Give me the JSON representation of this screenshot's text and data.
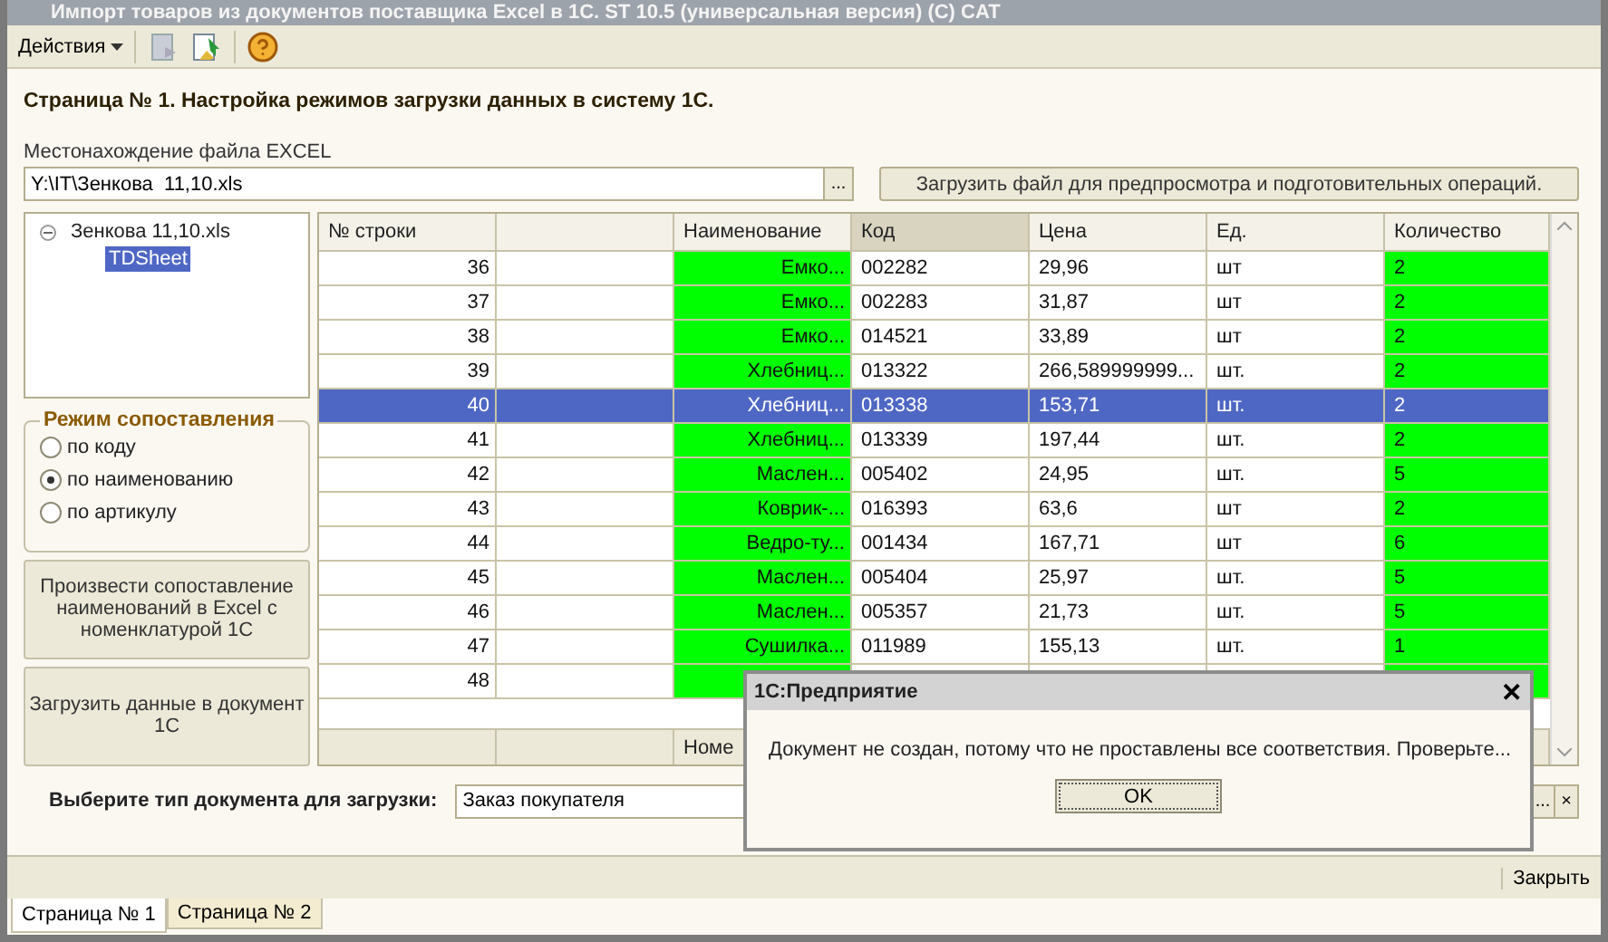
{
  "window": {
    "title": "Импорт товаров из документов поставщика Excel в 1С. ST 10.5 (универсальная версия) (С) CAT"
  },
  "toolbar": {
    "actions_menu": "Действия"
  },
  "heading": "Страница № 1. Настройка режимов загрузки данных в систему 1С.",
  "file": {
    "label": "Местонахождение файла EXCEL",
    "value": "Y:\\IT\\Зенкова  11,10.xls",
    "browse": "...",
    "load_button": "Загрузить файл для предпросмотра и подготовительных операций."
  },
  "tree": {
    "items": [
      {
        "label": "Зенкова  11,10.xls",
        "expanded": true,
        "selected": false,
        "children": [
          {
            "label": "TDSheet",
            "selected": true
          }
        ]
      }
    ]
  },
  "match_mode": {
    "title": "Режим сопоставления",
    "options": [
      {
        "label": "по коду",
        "selected": false
      },
      {
        "label": "по наименованию",
        "selected": true
      },
      {
        "label": "по артикулу",
        "selected": false
      }
    ]
  },
  "buttons": [
    "Произвести сопоставление наименований в Excel с номенклатурой 1С",
    "Загрузить данные в документ 1С"
  ],
  "table": {
    "columns": [
      "№ строки",
      "",
      "Наименование",
      "Код",
      "Цена",
      "Ед.",
      "Количество"
    ],
    "rows": [
      {
        "cells": [
          "36",
          "",
          "Емко...",
          "002282",
          "29,96",
          "шт",
          "2"
        ],
        "selected": false,
        "matched": true
      },
      {
        "cells": [
          "37",
          "",
          "Емко...",
          "002283",
          "31,87",
          "шт",
          "2"
        ],
        "selected": false,
        "matched": true
      },
      {
        "cells": [
          "38",
          "",
          "Емко...",
          "014521",
          "33,89",
          "шт",
          "2"
        ],
        "selected": false,
        "matched": true
      },
      {
        "cells": [
          "39",
          "",
          "Хлебниц...",
          "013322",
          "266,589999999...",
          "шт.",
          "2"
        ],
        "selected": false,
        "matched": true
      },
      {
        "cells": [
          "40",
          "",
          "Хлебниц...",
          "013338",
          "153,71",
          "шт.",
          "2"
        ],
        "selected": true,
        "matched": true
      },
      {
        "cells": [
          "41",
          "",
          "Хлебниц...",
          "013339",
          "197,44",
          "шт.",
          "2"
        ],
        "selected": false,
        "matched": true
      },
      {
        "cells": [
          "42",
          "",
          "Маслен...",
          "005402",
          "24,95",
          "шт.",
          "5"
        ],
        "selected": false,
        "matched": true
      },
      {
        "cells": [
          "43",
          "",
          "Коврик-...",
          "016393",
          "63,6",
          "шт",
          "2"
        ],
        "selected": false,
        "matched": true
      },
      {
        "cells": [
          "44",
          "",
          "Ведро-ту...",
          "001434",
          "167,71",
          "шт",
          "6"
        ],
        "selected": false,
        "matched": true
      },
      {
        "cells": [
          "45",
          "",
          "Маслен...",
          "005404",
          "25,97",
          "шт.",
          "5"
        ],
        "selected": false,
        "matched": true
      },
      {
        "cells": [
          "46",
          "",
          "Маслен...",
          "005357",
          "21,73",
          "шт.",
          "5"
        ],
        "selected": false,
        "matched": true
      },
      {
        "cells": [
          "47",
          "",
          "Сушилка...",
          "011989",
          "155,13",
          "шт.",
          "1"
        ],
        "selected": false,
        "matched": true
      },
      {
        "cells": [
          "48",
          "",
          "",
          "",
          "",
          "",
          ""
        ],
        "selected": false,
        "matched": true
      }
    ],
    "footer": {
      "column_3": "Номе"
    }
  },
  "doc_type": {
    "label": "Выберите тип документа для загрузки:",
    "value": "Заказ покупателя",
    "browse": "...",
    "clear": "×"
  },
  "status_bar": {
    "close": "Закрыть"
  },
  "page_tabs": [
    {
      "label": "Страница № 1",
      "selected": true
    },
    {
      "label": "Страница № 2",
      "selected": false
    }
  ],
  "dialog": {
    "title": "1С:Предприятие",
    "message": "Документ не создан, потому что не проставлены все соответствия. Проверьте...",
    "ok": "OK",
    "close": "✕"
  }
}
